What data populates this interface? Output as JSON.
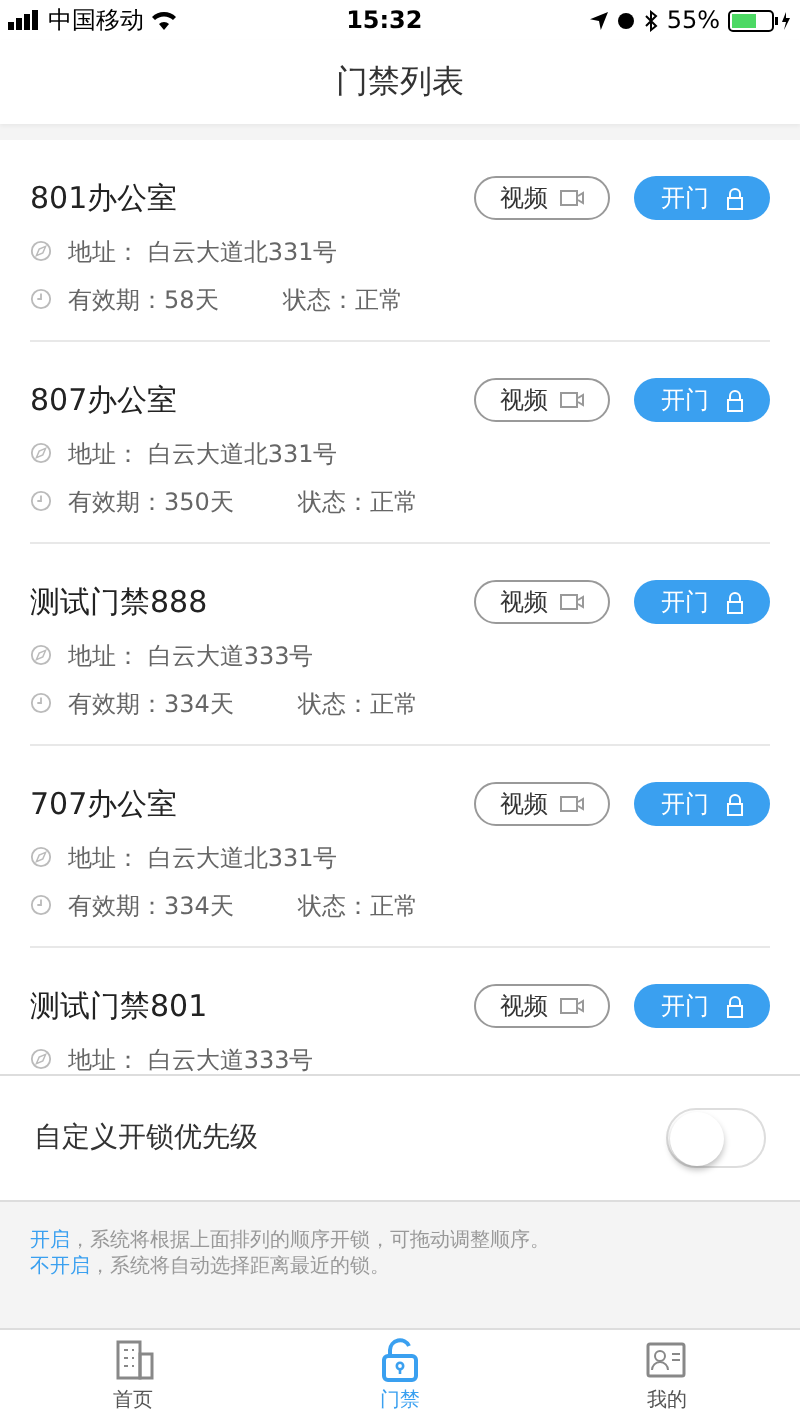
{
  "status_bar": {
    "carrier": "中国移动",
    "time": "15:32",
    "battery": "55%"
  },
  "nav": {
    "title": "门禁列表"
  },
  "doors": [
    {
      "name": "801办公室",
      "video_label": "视频",
      "open_label": "开门",
      "address": "地址： 白云大道北331号",
      "validity": "有效期：58天",
      "status": "状态：正常"
    },
    {
      "name": "807办公室",
      "video_label": "视频",
      "open_label": "开门",
      "address": "地址： 白云大道北331号",
      "validity": "有效期：350天",
      "status": "状态：正常"
    },
    {
      "name": "测试门禁888",
      "video_label": "视频",
      "open_label": "开门",
      "address": "地址： 白云大道333号",
      "validity": "有效期：334天",
      "status": "状态：正常"
    },
    {
      "name": "707办公室",
      "video_label": "视频",
      "open_label": "开门",
      "address": "地址： 白云大道北331号",
      "validity": "有效期：334天",
      "status": "状态：正常"
    },
    {
      "name": "测试门禁801",
      "video_label": "视频",
      "open_label": "开门",
      "address": "地址： 白云大道333号"
    }
  ],
  "priority": {
    "label": "自定义开锁优先级",
    "on": false
  },
  "notes": [
    {
      "lead": "开启",
      "text": "，系统将根据上面排列的顺序开锁，可拖动调整顺序。"
    },
    {
      "lead": "不开启",
      "text": "，系统将自动选择距离最近的锁。"
    }
  ],
  "tabs": [
    {
      "label": "首页",
      "selected": false
    },
    {
      "label": "门禁",
      "selected": true
    },
    {
      "label": "我的",
      "selected": false
    }
  ]
}
